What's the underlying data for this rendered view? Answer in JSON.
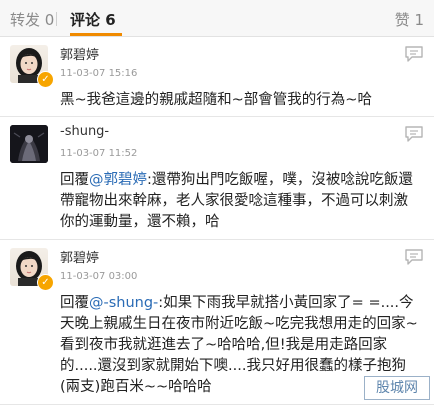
{
  "tabs": {
    "repost": "转发 0",
    "comment": "评论 6",
    "like": "赞 1"
  },
  "comments": [
    {
      "username": "郭碧婷",
      "time": "11-03-07 15:16",
      "text": "黑~我爸這邊的親戚超隨和~部會管我的行為~哈",
      "verified": true
    },
    {
      "username": "-shung-",
      "time": "11-03-07 11:52",
      "prefix": "回覆",
      "mention": "@郭碧婷",
      "text": ":還帶狗出門吃飯喔，噗，沒被唸說吃飯還帶寵物出來幹麻，老人家很愛唸這種事，不過可以刺激你的運動量，還不賴，哈",
      "verified": false
    },
    {
      "username": "郭碧婷",
      "time": "11-03-07 03:00",
      "prefix": "回覆",
      "mention": "@-shung-",
      "text": ":如果下雨我早就搭小黃回家了= =....今天晚上親戚生日在夜市附近吃飯~吃完我想用走的回家~看到夜市我就逛進去了~哈哈哈,但!我是用走路回家的.....還沒到家就開始下噢....我只好用很蠢的樣子抱狗(兩支)跑百米~~哈哈哈",
      "verified": true
    }
  ],
  "watermark": "股城网",
  "colors": {
    "accent": "#f08a00",
    "mention": "#2a6bb5",
    "verified": "#f7a500"
  },
  "icons": [
    "reply-icon",
    "verified-icon"
  ]
}
